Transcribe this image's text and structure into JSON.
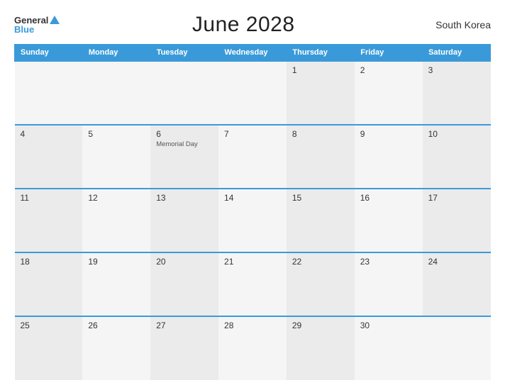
{
  "header": {
    "logo_general": "General",
    "logo_blue": "Blue",
    "title": "June 2028",
    "country": "South Korea"
  },
  "weekdays": [
    "Sunday",
    "Monday",
    "Tuesday",
    "Wednesday",
    "Thursday",
    "Friday",
    "Saturday"
  ],
  "weeks": [
    [
      {
        "day": "",
        "holiday": ""
      },
      {
        "day": "",
        "holiday": ""
      },
      {
        "day": "",
        "holiday": ""
      },
      {
        "day": "",
        "holiday": ""
      },
      {
        "day": "1",
        "holiday": ""
      },
      {
        "day": "2",
        "holiday": ""
      },
      {
        "day": "3",
        "holiday": ""
      }
    ],
    [
      {
        "day": "4",
        "holiday": ""
      },
      {
        "day": "5",
        "holiday": ""
      },
      {
        "day": "6",
        "holiday": "Memorial Day"
      },
      {
        "day": "7",
        "holiday": ""
      },
      {
        "day": "8",
        "holiday": ""
      },
      {
        "day": "9",
        "holiday": ""
      },
      {
        "day": "10",
        "holiday": ""
      }
    ],
    [
      {
        "day": "11",
        "holiday": ""
      },
      {
        "day": "12",
        "holiday": ""
      },
      {
        "day": "13",
        "holiday": ""
      },
      {
        "day": "14",
        "holiday": ""
      },
      {
        "day": "15",
        "holiday": ""
      },
      {
        "day": "16",
        "holiday": ""
      },
      {
        "day": "17",
        "holiday": ""
      }
    ],
    [
      {
        "day": "18",
        "holiday": ""
      },
      {
        "day": "19",
        "holiday": ""
      },
      {
        "day": "20",
        "holiday": ""
      },
      {
        "day": "21",
        "holiday": ""
      },
      {
        "day": "22",
        "holiday": ""
      },
      {
        "day": "23",
        "holiday": ""
      },
      {
        "day": "24",
        "holiday": ""
      }
    ],
    [
      {
        "day": "25",
        "holiday": ""
      },
      {
        "day": "26",
        "holiday": ""
      },
      {
        "day": "27",
        "holiday": ""
      },
      {
        "day": "28",
        "holiday": ""
      },
      {
        "day": "29",
        "holiday": ""
      },
      {
        "day": "30",
        "holiday": ""
      },
      {
        "day": "",
        "holiday": ""
      }
    ]
  ]
}
